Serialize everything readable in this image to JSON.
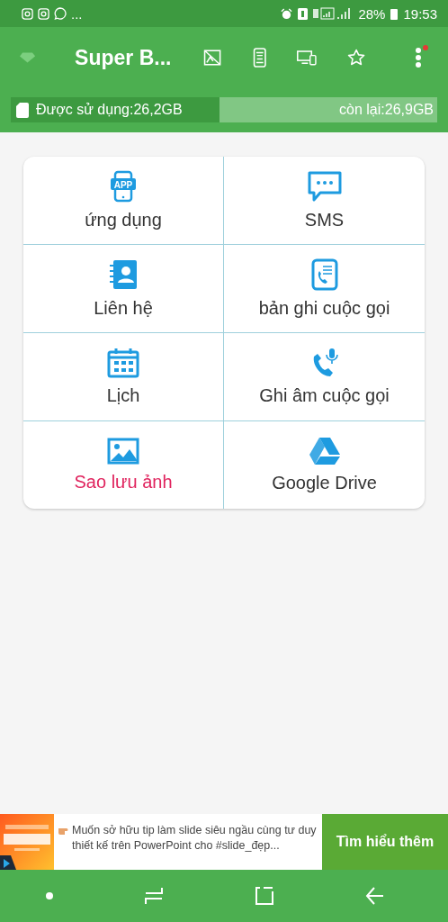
{
  "status_bar": {
    "more": "...",
    "battery": "28%",
    "time": "19:53"
  },
  "toolbar": {
    "title": "Super B...",
    "menu_badge": true
  },
  "storage": {
    "used": "Được sử dụng:26,2GB",
    "free": "còn lại:26,9GB",
    "level": 0.49
  },
  "tiles": [
    {
      "label": "ứng dụng",
      "icon_text": "APP",
      "highlighted": false
    },
    {
      "label": "SMS",
      "highlighted": false
    },
    {
      "label": "Liên hệ",
      "highlighted": false
    },
    {
      "label": "bản ghi cuộc gọi",
      "highlighted": false
    },
    {
      "label": "Lịch",
      "highlighted": false
    },
    {
      "label": "Ghi âm cuộc gọi",
      "highlighted": false
    },
    {
      "label": "Sao lưu ảnh",
      "highlighted": true
    },
    {
      "label": "Google Drive",
      "highlighted": false
    }
  ],
  "ad": {
    "kind": "picture",
    "text": "Muốn sở hữu tip làm slide siêu ngầu cùng tư duy thiết kế trên PowerPoint cho #slide_đẹp...",
    "button": "Tìm hiểu thêm"
  }
}
